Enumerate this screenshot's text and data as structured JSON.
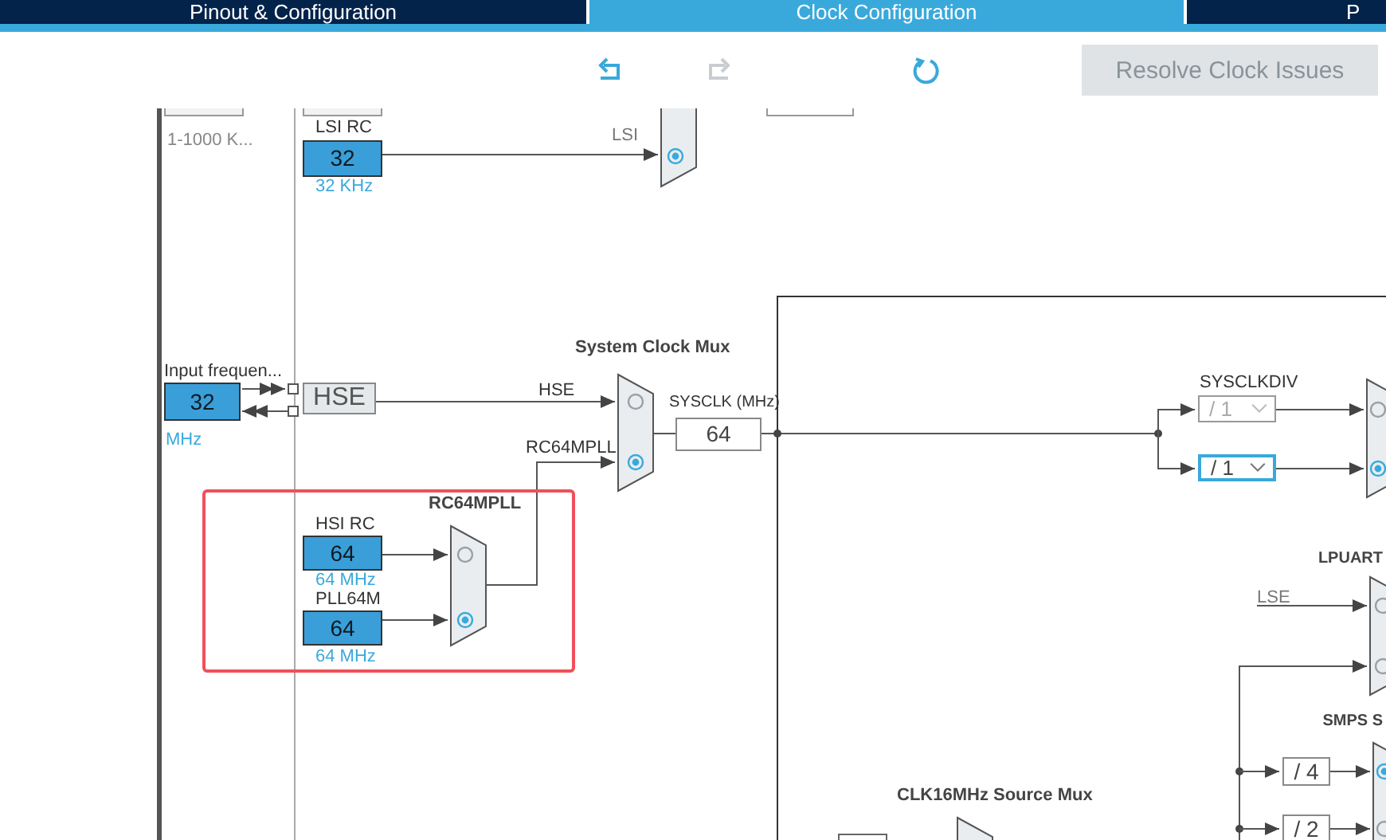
{
  "tabs": [
    {
      "label": "Pinout & Configuration",
      "selected": false
    },
    {
      "label": "Clock Configuration",
      "selected": true
    },
    {
      "label": "P",
      "selected": false
    }
  ],
  "toolbar": {
    "undo": {
      "disabled": false
    },
    "redo": {
      "disabled": true
    },
    "refresh": {
      "disabled": false
    },
    "resolve_button": {
      "label": "Resolve Clock Issues",
      "disabled": true
    }
  },
  "diagram": {
    "range_label": "1-1000 K...",
    "lsi": {
      "title": "LSI RC",
      "value": "32",
      "unit": "32 KHz",
      "line_label": "LSI",
      "mux_selected": true
    },
    "hse": {
      "title": "Input frequen...",
      "value": "32",
      "unit": "MHz",
      "label": "HSE"
    },
    "system_mux": {
      "title": "System Clock Mux",
      "inputs": [
        {
          "label": "HSE",
          "selected": false
        },
        {
          "label": "RC64MPLL",
          "selected": true
        }
      ]
    },
    "sysclk": {
      "title": "SYSCLK (MHz)",
      "value": "64"
    },
    "sysclkdiv": {
      "title": "SYSCLKDIV",
      "dividers": [
        {
          "value": "/ 1",
          "disabled": true,
          "selected": false
        },
        {
          "value": "/ 1",
          "disabled": false,
          "selected": true
        }
      ],
      "mux_inputs": [
        {
          "selected": false
        },
        {
          "selected": true
        }
      ]
    },
    "rc64mpll": {
      "title": "RC64MPLL",
      "highlighted": true,
      "sources": [
        {
          "title": "HSI RC",
          "value": "64",
          "unit": "64 MHz",
          "selected": false
        },
        {
          "title": "PLL64M",
          "value": "64",
          "unit": "64 MHz",
          "selected": true
        }
      ]
    },
    "lpuart": {
      "title": "LPUART",
      "line_label": "LSE",
      "mux_inputs": [
        {
          "selected": false
        },
        {
          "selected": false
        }
      ]
    },
    "smps": {
      "title": "SMPS S",
      "dividers": [
        {
          "value": "/ 4",
          "selected": true
        },
        {
          "value": "/ 2",
          "selected": false
        }
      ]
    },
    "clk16": {
      "title": "CLK16MHz Source Mux"
    }
  }
}
